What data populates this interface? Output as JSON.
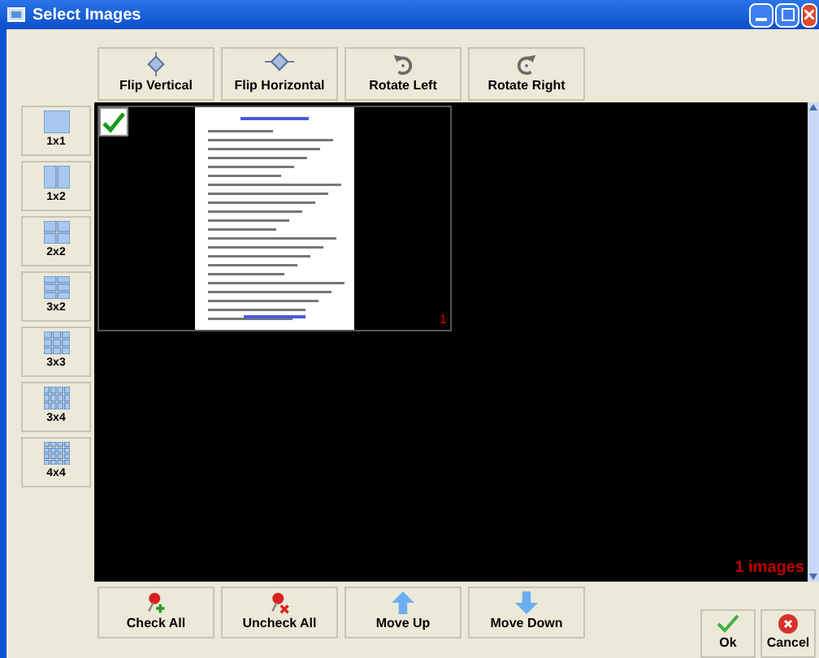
{
  "window": {
    "title": "Select Images"
  },
  "toolbar": [
    {
      "label": "Flip Vertical",
      "kind": "flipv"
    },
    {
      "label": "Flip Horizontal",
      "kind": "fliph"
    },
    {
      "label": "Rotate Left",
      "kind": "rotl"
    },
    {
      "label": "Rotate Right",
      "kind": "rotr"
    }
  ],
  "layouts": [
    {
      "label": "1x1"
    },
    {
      "label": "1x2"
    },
    {
      "label": "2x2"
    },
    {
      "label": "3x2"
    },
    {
      "label": "3x3"
    },
    {
      "label": "3x4"
    },
    {
      "label": "4x4"
    }
  ],
  "thumbnails": [
    {
      "number": "1",
      "checked": true
    }
  ],
  "image_count": "1 images",
  "actions": [
    {
      "label": "Check All",
      "kind": "check"
    },
    {
      "label": "Uncheck All",
      "kind": "uncheck"
    },
    {
      "label": "Move Up",
      "kind": "up"
    },
    {
      "label": "Move Down",
      "kind": "down"
    }
  ],
  "dialog_buttons": [
    {
      "label": "Ok",
      "kind": "ok"
    },
    {
      "label": "Cancel",
      "kind": "cancel"
    }
  ]
}
